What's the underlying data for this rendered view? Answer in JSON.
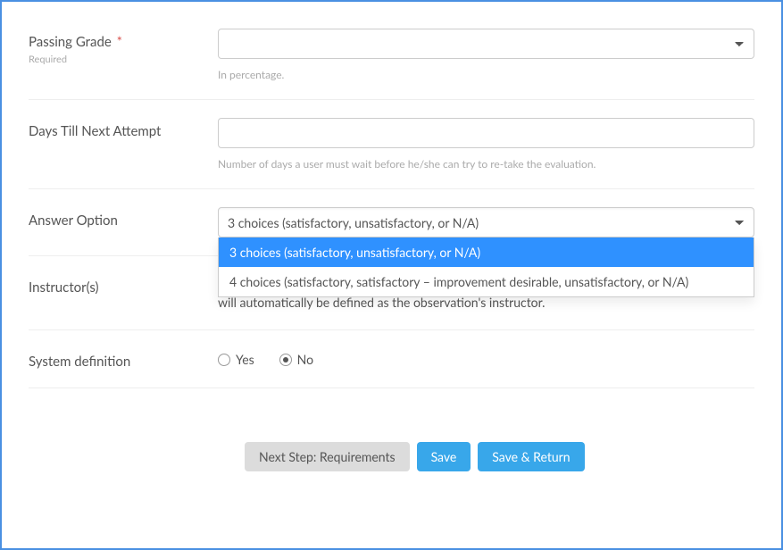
{
  "passingGrade": {
    "label": "Passing Grade",
    "requiredMark": "*",
    "requiredText": "Required",
    "value": "",
    "help": "In percentage."
  },
  "daysTillNext": {
    "label": "Days Till Next Attempt",
    "value": "",
    "help": "Number of days a user must wait before he/she can try to re-take the evaluation."
  },
  "answerOption": {
    "label": "Answer Option",
    "selected": "3 choices (satisfactory, unsatisfactory, or N/A)",
    "options": [
      "3 choices (satisfactory, unsatisfactory, or N/A)",
      "4 choices (satisfactory, satisfactory – improvement desirable, unsatisfactory, or N/A)"
    ]
  },
  "instructors": {
    "label": "Instructor(s)",
    "text": "No instructor can be defined for this type of observation. The person responsible for the training will automatically be defined as the observation's instructor."
  },
  "systemDefinition": {
    "label": "System definition",
    "yesLabel": "Yes",
    "noLabel": "No",
    "value": "No"
  },
  "buttons": {
    "nextStep": "Next Step: Requirements",
    "save": "Save",
    "saveReturn": "Save & Return"
  }
}
